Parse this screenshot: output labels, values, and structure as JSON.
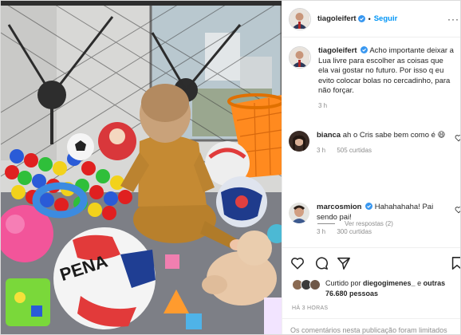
{
  "post": {
    "username": "tiagoleifert",
    "follow_label": "Seguir",
    "separator": "•",
    "more_label": "···"
  },
  "caption": {
    "username": "tiagoleifert",
    "text": "Acho importante deixar a Lua livre para escolher as coisas que ela vai gostar no futuro. Por isso q eu evito colocar bolas no cercadinho, para não forçar.",
    "time": "3 h"
  },
  "comments": [
    {
      "username": "bianca",
      "text": "ah o Cris sabe bem como é 😄",
      "time": "3 h",
      "likes": "505 curtidas"
    },
    {
      "username": "marcosmion",
      "text": "Hahahahaha! Pai sendo pai!",
      "time": "3 h",
      "likes": "300 curtidas"
    }
  ],
  "replies_label": "Ver respostas (2)",
  "likes": {
    "prefix": "Curtido por",
    "user": "diegogimenes_",
    "conjunction": "e",
    "others": "outras 76.680 pessoas"
  },
  "timestamp": "HÁ 3 HORAS",
  "comments_limited": "Os comentários nesta publicação foram limitados",
  "icons": [
    "verified-icon",
    "more-icon",
    "heart-icon",
    "comment-icon",
    "share-icon",
    "bookmark-icon"
  ],
  "colors": {
    "accent": "#0095f6",
    "verified": "#3897f0",
    "muted": "#8e8e8e",
    "text": "#262626"
  }
}
